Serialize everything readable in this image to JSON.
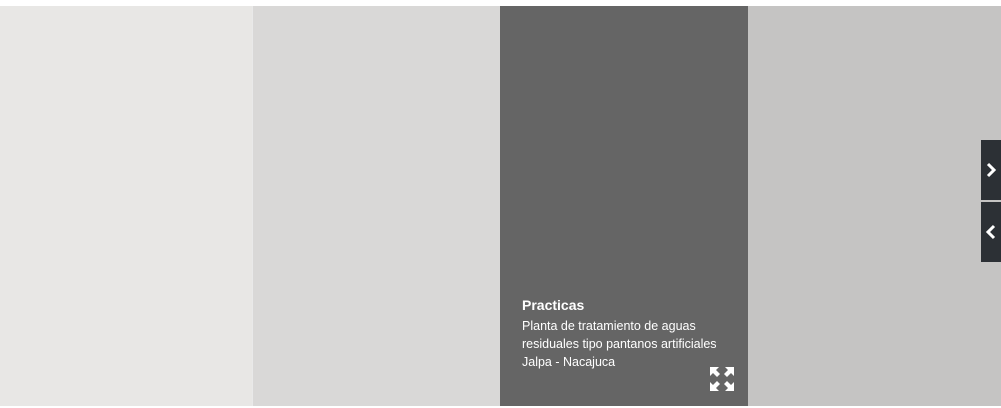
{
  "gallery": {
    "panels": [
      {
        "name": "panel-1",
        "color": "#e8e7e5"
      },
      {
        "name": "panel-2",
        "color": "#d9d8d7"
      },
      {
        "name": "panel-3",
        "color": "#656565"
      },
      {
        "name": "panel-4",
        "color": "#c5c4c3"
      }
    ],
    "active_caption": {
      "title": "Practicas",
      "line1": "Planta de tratamiento de aguas",
      "line2": "residuales tipo pantanos artificiales",
      "line3": "Jalpa - Nacajuca"
    },
    "expand_icon": "expand-arrows-icon"
  },
  "navigation": {
    "next_icon": "chevron-right-icon",
    "prev_icon": "chevron-left-icon",
    "button_color": "#2c3035"
  }
}
